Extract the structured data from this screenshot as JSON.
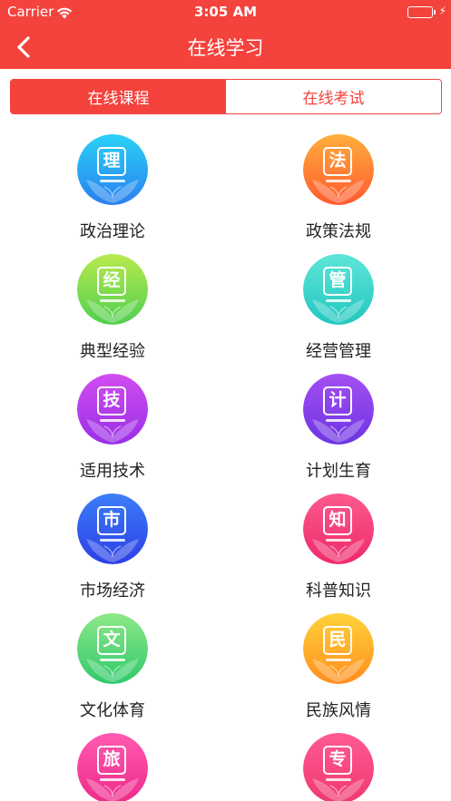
{
  "status": {
    "carrier": "Carrier",
    "time": "3:05 AM"
  },
  "nav": {
    "title": "在线学习",
    "back_icon": "chevron-left-icon"
  },
  "tabs": [
    {
      "label": "在线课程",
      "active": true
    },
    {
      "label": "在线考试",
      "active": false
    }
  ],
  "colors": {
    "brand": "#f4423d"
  },
  "categories": [
    {
      "label": "政治理论",
      "glyph": "理",
      "c1": "#2ad1f6",
      "c2": "#2a7ff0"
    },
    {
      "label": "政策法规",
      "glyph": "法",
      "c1": "#ffae3b",
      "c2": "#ff5a30"
    },
    {
      "label": "典型经验",
      "glyph": "经",
      "c1": "#b8ea4e",
      "c2": "#4fcf4f"
    },
    {
      "label": "经营管理",
      "glyph": "管",
      "c1": "#5fe5d8",
      "c2": "#21c7c0"
    },
    {
      "label": "适用技术",
      "glyph": "技",
      "c1": "#d04ef1",
      "c2": "#9a2ee6"
    },
    {
      "label": "计划生育",
      "glyph": "计",
      "c1": "#a44ff2",
      "c2": "#6d35e3"
    },
    {
      "label": "市场经济",
      "glyph": "市",
      "c1": "#3c7ef8",
      "c2": "#2c3fe6"
    },
    {
      "label": "科普知识",
      "glyph": "知",
      "c1": "#fc5a8e",
      "c2": "#ef2a6a"
    },
    {
      "label": "文化体育",
      "glyph": "文",
      "c1": "#8ee888",
      "c2": "#2fc96a"
    },
    {
      "label": "民族风情",
      "glyph": "民",
      "c1": "#ffd23a",
      "c2": "#ff8e1f"
    },
    {
      "label": "",
      "glyph": "旅",
      "c1": "#ff5bb0",
      "c2": "#ee2a8a"
    },
    {
      "label": "",
      "glyph": "专",
      "c1": "#ff5a94",
      "c2": "#f0386f"
    }
  ]
}
